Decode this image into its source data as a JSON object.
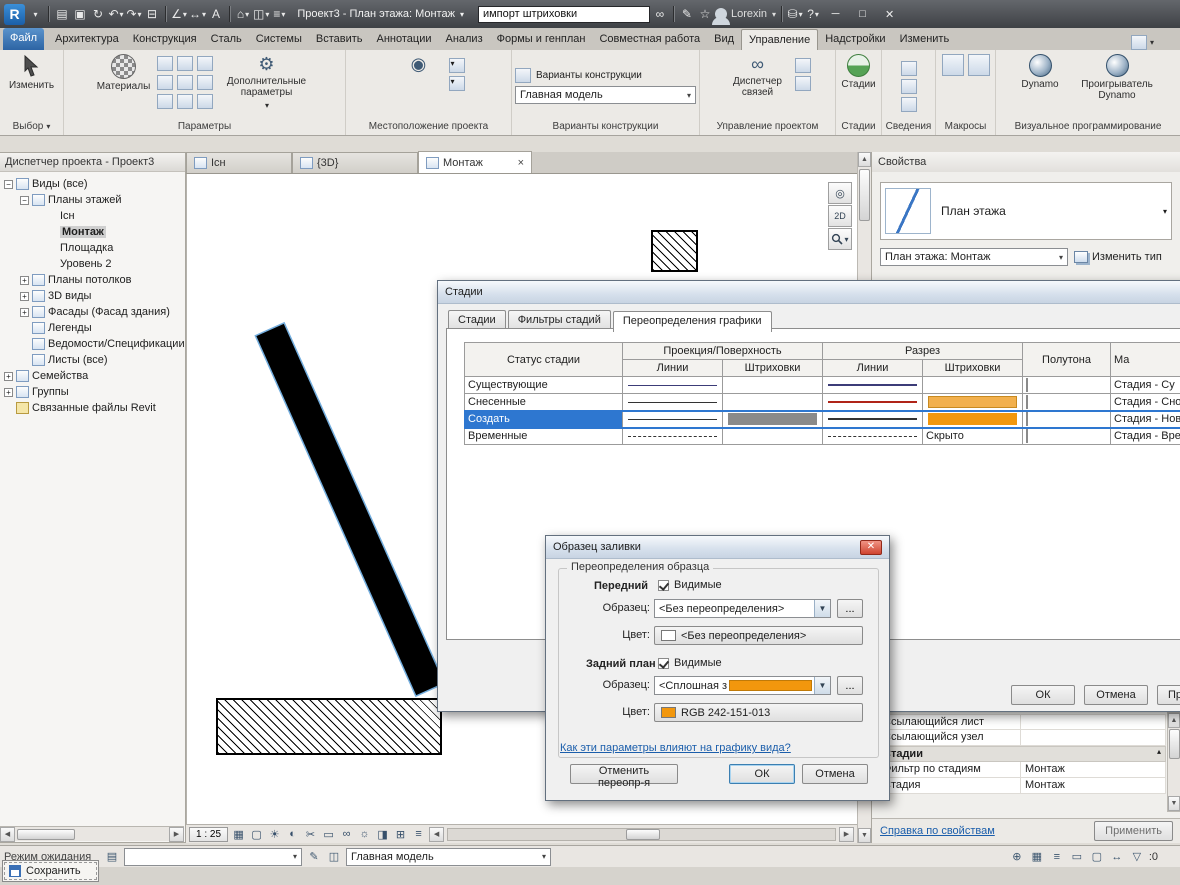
{
  "titlebar": {
    "logo": "R",
    "title": "Проект3 - План этажа: Монтаж",
    "search_value": "импорт штриховки",
    "user": "Lorexin"
  },
  "ribbon_tabs": {
    "items": [
      "Файл",
      "Архитектура",
      "Конструкция",
      "Сталь",
      "Системы",
      "Вставить",
      "Аннотации",
      "Анализ",
      "Формы и генплан",
      "Совместная работа",
      "Вид",
      "Управление",
      "Надстройки",
      "Изменить"
    ]
  },
  "ribbon": {
    "select": {
      "label": "Выбор",
      "modify": "Изменить"
    },
    "settings": {
      "label": "Параметры",
      "materials": "Материалы",
      "additional": "Дополнительные параметры"
    },
    "location": {
      "label": "Местоположение проекта"
    },
    "design_options": {
      "label": "Варианты конструкции",
      "button": "Варианты конструкции",
      "main_model": "Главная модель"
    },
    "manage_project": {
      "label": "Управление проектом",
      "links_manager": "Диспетчер связей"
    },
    "phasing": {
      "label": "Стадии",
      "button": "Стадии"
    },
    "inquiry": {
      "label": "Сведения"
    },
    "macros": {
      "label": "Макросы"
    },
    "visual_programming": {
      "label": "Визуальное программирование",
      "dynamo": "Dynamo",
      "dynamo_player": "Проигрыватель Dynamo"
    }
  },
  "project_browser": {
    "title": "Диспетчер проекта - Проект3",
    "items": [
      {
        "label": "Виды (все)",
        "expander": "−"
      },
      {
        "label": "Планы этажей",
        "expander": "−"
      },
      {
        "label": "Існ",
        "expander": ""
      },
      {
        "label": "Монтаж",
        "expander": ""
      },
      {
        "label": "Площадка",
        "expander": ""
      },
      {
        "label": "Уровень 2",
        "expander": ""
      },
      {
        "label": "Планы потолков",
        "expander": "+"
      },
      {
        "label": "3D виды",
        "expander": "+"
      },
      {
        "label": "Фасады (Фасад здания)",
        "expander": "+"
      },
      {
        "label": "Легенды",
        "expander": ""
      },
      {
        "label": "Ведомости/Спецификации (",
        "expander": ""
      },
      {
        "label": "Листы (все)",
        "expander": ""
      },
      {
        "label": "Семейства",
        "expander": "+"
      },
      {
        "label": "Группы",
        "expander": "+"
      },
      {
        "label": "Связанные файлы Revit",
        "expander": ""
      }
    ]
  },
  "view_tabs": {
    "tab1": "Існ",
    "tab2": "{3D}",
    "tab3": "Монтаж"
  },
  "properties": {
    "header": "Свойства",
    "preview_label": "План этажа",
    "type_selector": "План этажа: Монтаж",
    "edit_type": "Изменить тип"
  },
  "phases_dialog": {
    "title": "Стадии",
    "tab1": "Стадии",
    "tab2": "Фильтры стадий",
    "tab3": "Переопределения графики",
    "header": {
      "status": "Статус стадии",
      "projection": "Проекция/Поверхность",
      "cut": "Разрез",
      "lines": "Линии",
      "patterns": "Штриховки",
      "halftone": "Полутона",
      "material": "Ма"
    },
    "rows": [
      {
        "status": "Существующие",
        "material": "Стадия - Су"
      },
      {
        "status": "Снесенные",
        "material": "Стадия - Сно"
      },
      {
        "status": "Создать",
        "material": "Стадия - Нов"
      },
      {
        "status": "Временные",
        "cut_pattern": "Скрыто",
        "material": "Стадия - Вре"
      }
    ],
    "ok": "ОК",
    "cancel": "Отмена",
    "apply": "Применить"
  },
  "fill_dialog": {
    "title": "Образец заливки",
    "group": "Переопределения образца",
    "foreground": "Передний",
    "background": "Задний план",
    "visible": "Видимые",
    "pattern_label": "Образец:",
    "color_label": "Цвет:",
    "fg_pattern": "<Без переопределения>",
    "fg_color": "<Без переопределения>",
    "bg_pattern": "<Сплошная з",
    "bg_color": "RGB 242-151-013",
    "browse": "...",
    "link": "Как эти параметры влияют на графику вида?",
    "clear": "Отменить переопр-я",
    "ok": "ОК",
    "cancel": "Отмена"
  },
  "properties_bottom": {
    "row1": "Ссылающийся лист",
    "row2": "Ссылающийся узел",
    "group": "Стадии",
    "row3": "Фильтр по стадиям",
    "row3_value": "Монтаж",
    "row4": "Стадия",
    "row4_value": "Монтаж",
    "help": "Справка по свойствам",
    "apply": "Применить"
  },
  "view_control_bar": {
    "scale": "1 : 25"
  },
  "status_bar": {
    "status_text": "Режим ожидания",
    "main_model": "Главная модель",
    "selection_count": ":0",
    "save": "Сохранить"
  },
  "colors": {
    "accent_orange": "#F2970D",
    "selection_blue": "#2E77D0",
    "demolish_red": "#B02418"
  },
  "icons": {
    "open": "▤",
    "save": "▣",
    "sync": "↻",
    "undo": "↶",
    "redo": "↷",
    "print": "⊟",
    "measure": "∠",
    "dimension": "↔",
    "text": "A",
    "home": "⌂",
    "section": "◫",
    "thin_lines": "≡",
    "binoculars": "∞",
    "favorites": "☆",
    "pencil": "✎",
    "help": "?",
    "detail_level": "▦",
    "visual_style": "▢",
    "sun": "☀",
    "shadows": "◐",
    "crop": "✂",
    "crop_show": "▭",
    "hide_isolate": "∞",
    "reveal": "☼",
    "temp_view": "◨",
    "worksharing": "⊞",
    "constraints": "≡",
    "worksets": "▤",
    "editable": "✎",
    "links": "⊕",
    "graphics": "▦",
    "filter": "▽",
    "wheel": "◎",
    "zoom2d": "2D"
  }
}
